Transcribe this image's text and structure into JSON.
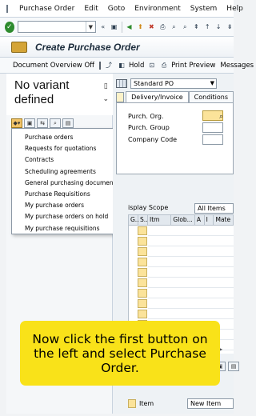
{
  "menubar": {
    "items": [
      "Purchase Order",
      "Edit",
      "Goto",
      "Environment",
      "System",
      "Help"
    ]
  },
  "title": "Create Purchase Order",
  "appbar": {
    "doc_overview": "Document Overview Off",
    "hold": "Hold",
    "print_preview": "Print Preview",
    "messages": "Messages"
  },
  "variant": {
    "text": "No variant defined"
  },
  "popup_menu": {
    "items": [
      "Purchase orders",
      "Requests for quotations",
      "Contracts",
      "Scheduling agreements",
      "General purchasing documents",
      "Purchase Requisitions",
      "My purchase orders",
      "My purchase orders on hold",
      "My purchase requisitions"
    ]
  },
  "header": {
    "order_type": "Standard PO",
    "tabs": [
      "Delivery/Invoice",
      "Conditions"
    ],
    "fields": {
      "purch_org": "Purch. Org.",
      "purch_group": "Purch. Group",
      "company_code": "Company Code"
    }
  },
  "items_overview": {
    "display_scope_label": "isplay Scope",
    "display_scope_value": "All Items",
    "columns": [
      "G..",
      "S..",
      "Itm",
      "Glob...",
      "A",
      "I",
      "Mate"
    ],
    "item_label": "Item",
    "new_item": "New Item"
  },
  "instruction": {
    "text": "Now click the first button on the left and select Purchase Order."
  },
  "colors": {
    "callout": "#f9e219",
    "required_field": "#fbe39a",
    "title_text": "#1a2a3a"
  }
}
